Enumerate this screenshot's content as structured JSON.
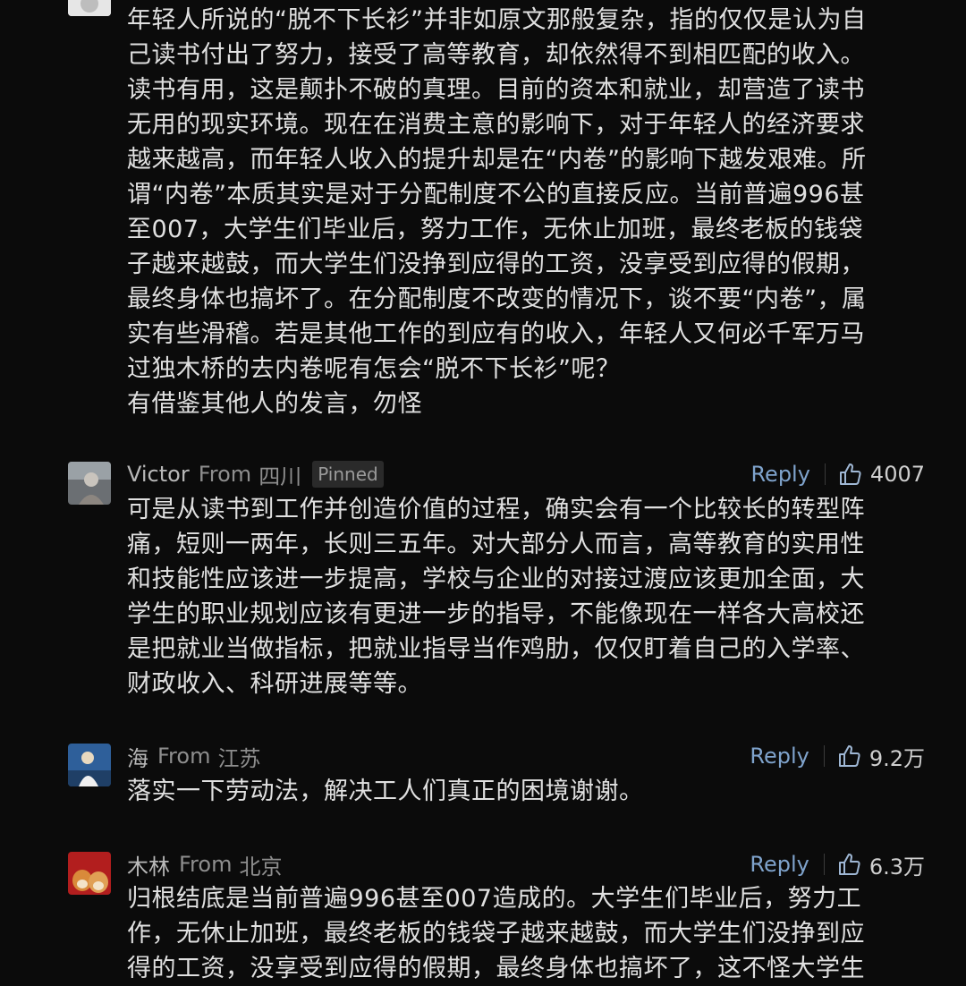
{
  "comments": [
    {
      "id": "c0",
      "name": "",
      "body_lines": [
        "年轻人所说的“脱不下长衫”并非如原文那般复杂，指的仅仅是认为自",
        "己读书付出了努力，接受了高等教育，却依然得不到相匹配的收入。",
        "读书有用，这是颠扑不破的真理。目前的资本和就业，却营造了读书",
        "无用的现实环境。现在在消费主意的影响下，对于年轻人的经济要求",
        "越来越高，而年轻人收入的提升却是在“内卷”的影响下越发艰难。所",
        "谓“内卷”本质其实是对于分配制度不公的直接反应。当前普遍996甚",
        "至007，大学生们毕业后，努力工作，无休止加班，最终老板的钱袋",
        "子越来越鼓，而大学生们没挣到应得的工资，没享受到应得的假期，",
        "最终身体也搞坏了。在分配制度不改变的情况下，谈不要“内卷”，属",
        "实有些滑稽。若是其他工作的到应有的收入，年轻人又何必千军万马",
        "过独木桥的去内卷呢有怎会“脱不下长衫”呢？",
        "有借鉴其他人的发言，勿怪"
      ]
    },
    {
      "id": "c1",
      "name": "Victor",
      "from": "From",
      "region": "四川",
      "badge": "Pinned",
      "reply": "Reply",
      "likes": "4007",
      "body_lines": [
        "可是从读书到工作并创造价值的过程，确实会有一个比较长的转型阵",
        "痛，短则一两年，长则三五年。对大部分人而言，高等教育的实用性",
        "和技能性应该进一步提高，学校与企业的对接过渡应该更加全面，大",
        "学生的职业规划应该有更进一步的指导，不能像现在一样各大高校还",
        "是把就业当做指标，把就业指导当作鸡肋，仅仅盯着自己的入学率、",
        "财政收入、科研进展等等。"
      ]
    },
    {
      "id": "c2",
      "name": "海",
      "from": "From",
      "region": "江苏",
      "reply": "Reply",
      "likes": "9.2万",
      "body_lines": [
        "落实一下劳动法，解决工人们真正的困境谢谢。"
      ]
    },
    {
      "id": "c3",
      "name": "木林",
      "from": "From",
      "region": "北京",
      "reply": "Reply",
      "likes": "6.3万",
      "body_lines": [
        "归根结底是当前普遍996甚至007造成的。大学生们毕业后，努力工",
        "作，无休止加班，最终老板的钱袋子越来越鼓，而大学生们没挣到应",
        "得的工资，没享受到应得的假期，最终身体也搞坏了，这不怪大学生"
      ]
    }
  ],
  "icons": {
    "like": "thumbs-up-outline-icon"
  },
  "colors": {
    "background": "#0b0b0b",
    "reply": "#7fa3cc",
    "text": "#e0e0e0",
    "meta": "#8e8e8e"
  }
}
